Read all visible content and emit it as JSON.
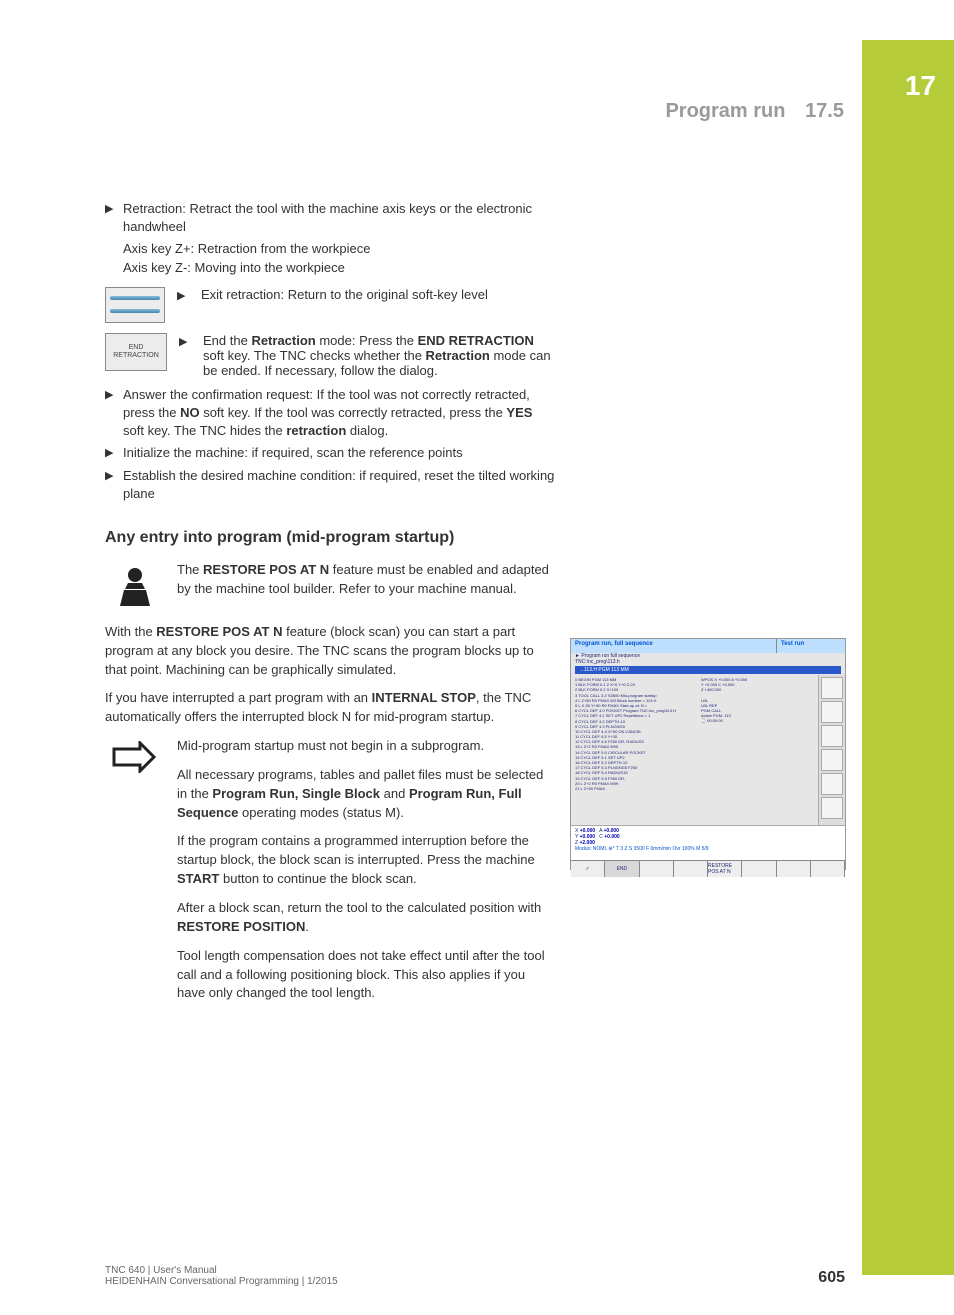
{
  "chapter_tab": "17",
  "header": {
    "title": "Program run",
    "section": "17.5"
  },
  "body": {
    "b1": "Retraction: Retract the tool with the machine axis keys or the electronic handwheel",
    "b1a": "Axis key Z+: Retraction from the workpiece",
    "b1b": "Axis key Z-: Moving into the workpiece",
    "k1": "Exit retraction: Return to the original soft-key level",
    "k2_label_l1": "END",
    "k2_label_l2": "RETRACTION",
    "k2a": "End the ",
    "k2b": "Retraction",
    "k2c": " mode: Press the ",
    "k2d": "END RETRACTION",
    "k2e": " soft key. The TNC checks whether the ",
    "k2f": "Retraction",
    "k2g": " mode can be ended. If necessary, follow the dialog.",
    "b2a": "Answer the confirmation request: If the tool was not correctly retracted, press the ",
    "b2b": "NO",
    "b2c": " soft key. If the tool was correctly retracted, press the ",
    "b2d": "YES",
    "b2e": " soft key. The TNC hides the ",
    "b2f": "retraction",
    "b2g": " dialog.",
    "b3": "Initialize the machine: if required, scan the reference points",
    "b4": "Establish the desired machine condition: if required, reset the tilted working plane",
    "h3": "Any entry into program (mid-program startup)",
    "note1a": "The ",
    "note1b": "RESTORE POS AT N",
    "note1c": " feature must be enabled and adapted by the machine tool builder. Refer to your machine manual.",
    "p1a": "With the ",
    "p1b": "RESTORE POS AT N",
    "p1c": " feature (block scan) you can start a part program at any block you desire. The TNC scans the program blocks up to that point. Machining can be graphically simulated.",
    "p2a": "If you have interrupted a part program with an ",
    "p2b": "INTERNAL STOP",
    "p2c": ", the TNC automatically offers the interrupted block N for mid-program startup.",
    "n1": "Mid-program startup must not begin in a subprogram.",
    "n2a": "All necessary programs, tables and pallet files must be selected in the ",
    "n2b": "Program Run, Single Block",
    "n2c": " and ",
    "n2d": "Program Run, Full Sequence",
    "n2e": " operating modes (status M).",
    "n3a": "If the program contains a programmed interruption before the startup block, the block scan is interrupted. Press the machine ",
    "n3b": "START",
    "n3c": " button to continue the block scan.",
    "n4a": "After a block scan, return the tool to the calculated position with ",
    "n4b": "RESTORE POSITION",
    "n4c": ".",
    "n5": "Tool length compensation does not take effect until after the tool call and a following positioning block. This also applies if you have only changed the tool length."
  },
  "screenshot": {
    "title1": "Program run, full sequence",
    "title2": "Test run",
    "sub": "► Program run full sequence",
    "file": "TNC:\\nc_prog\\113.h",
    "blue_row": "→113.H PGM 113 MM",
    "list": [
      "0  BEGIN PGM 113 MM",
      "1  BLK FORM 0.1 Z X+0 Y+0 Z-20",
      "2  BLK FORM 0.2  X+100",
      "3  TOOL CALL 3 Z S3500     Mid-program startup",
      "4  L Z+50 R0 FMAX M3         Block number   = 113.H",
      "5  L X-30 Y+50 R0 FMAX Start-up at: N =",
      "6  CYCL DEF 4.0 POCKET  Program        TNC:\\nc_prog\\113.H",
      "7  CYCL DEF 4.1 SET UP2   Repetitions    = 1",
      "8  CYCL DEF 4.2 DEPTH-10",
      "9  CYCL DEF 4.3 PLNGNG5",
      "10 CYCL DEF 4.4 X+50                       OK                CANCEL",
      "11 CYCL DEF 4.5 Y+30",
      "12 CYCL DEF 4.6 F250 DR- RADIUS3",
      "13 L Z+2 R0 FMAX M99",
      "14 CYCL DEF 5.0 CIRCULAR POCKET",
      "15 CYCL DEF 5.1 SET UP2",
      "16 CYCL DEF 5.2 DEPTH-10",
      "17 CYCL DEF 5.3 PLNGNG5 F250",
      "18 CYCL DEF 5.4 RADIUS15",
      "19 CYCL DEF 5.5 F350 DR-",
      "20 L  Z+2 R0 FMAX M99",
      "21 L  Z+50 FMAX"
    ],
    "right_panel": [
      "LBL",
      "LBL    REP",
      "PGM CALL",
      "Active PGM: 113",
      "⌚ 00:00:00"
    ],
    "coords_top": [
      "WPOS X  +0.000   A  +0.000",
      "Y  +0.000   C  +0.000",
      "Z  +400.000"
    ],
    "dro": {
      "X": "+0.000",
      "Y": "+0.000",
      "Z": "+2.000",
      "A": "+0.000",
      "C": "+0.000"
    },
    "status_line": "Modus: NOML    ⊕*    T 3    Z S 3500    F 0mm/min    Ovr 100%    M 5/9",
    "bottom_keys": [
      "✓",
      "END",
      "",
      "",
      "RESTORE POS AT N",
      "",
      "",
      ""
    ]
  },
  "footer": {
    "l1": "TNC 640 | User's Manual",
    "l2": "HEIDENHAIN Conversational Programming | 1/2015",
    "page": "605"
  }
}
